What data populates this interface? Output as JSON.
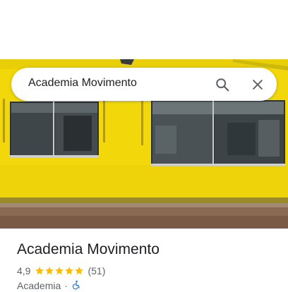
{
  "search": {
    "query": "Academia Movimento"
  },
  "icons": {
    "search": "search-icon",
    "close": "close-icon",
    "star": "star-icon",
    "wheelchair": "wheelchair-accessible-icon"
  },
  "place": {
    "name": "Academia Movimento",
    "rating": "4,9",
    "stars_filled": 5,
    "review_count": "(51)",
    "category": "Academia",
    "separator": "·"
  },
  "colors": {
    "wall_yellow": "#f2d80a",
    "star_gold": "#fbbc04",
    "accessibility_blue": "#1a73e8",
    "text_primary": "#202124",
    "text_secondary": "#5f6368"
  }
}
